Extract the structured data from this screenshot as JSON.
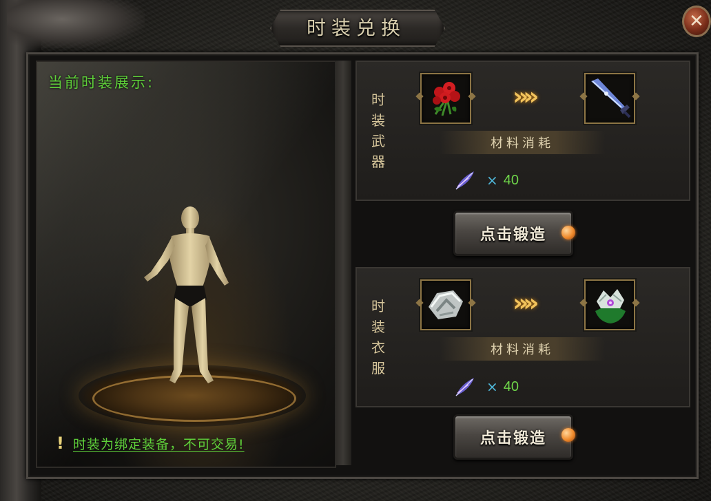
{
  "window": {
    "title": "时装兑换",
    "close_label": "✕"
  },
  "showcase": {
    "title": "当前时装展示:",
    "notice_mark": "!",
    "notice": "时装为绑定装备，不可交易!"
  },
  "sections": [
    {
      "label": "时装武器",
      "source_item": "red-rose-bouquet",
      "target_item": "blue-crystal-sword",
      "arrows": "»",
      "materials_label": "材料消耗",
      "material_icon": "feather-quill",
      "times": "×",
      "quantity": "40",
      "forge_label": "点击锻造"
    },
    {
      "label": "时装衣服",
      "source_item": "silver-armor",
      "target_item": "green-fashion-outfit",
      "arrows": "»",
      "materials_label": "材料消耗",
      "material_icon": "feather-quill",
      "times": "×",
      "quantity": "40",
      "forge_label": "点击锻造"
    }
  ],
  "colors": {
    "green_text": "#5fd13a",
    "gold_frame": "#8d7545",
    "arrow_gold": "#f2c35c",
    "forge_dot": "#ef8a2c"
  }
}
